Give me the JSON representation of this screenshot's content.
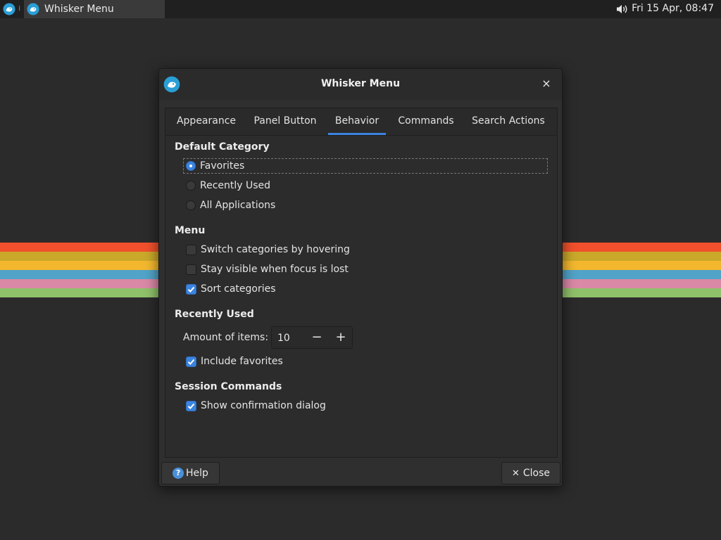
{
  "panel": {
    "menu_icon": "whisker-menu-icon",
    "separator_glyph": "⁞",
    "task_title": "Whisker Menu",
    "volume_icon": "volume-icon",
    "clock": "Fri 15 Apr, 08:47"
  },
  "wallpaper": {
    "stripe_colors": [
      "#f0512c",
      "#c9a82a",
      "#f3b72e",
      "#51a3c7",
      "#d989a5",
      "#8fc06a"
    ]
  },
  "dialog": {
    "title": "Whisker Menu",
    "close_glyph": "×",
    "tabs": [
      {
        "label": "Appearance",
        "active": false
      },
      {
        "label": "Panel Button",
        "active": false
      },
      {
        "label": "Behavior",
        "active": true
      },
      {
        "label": "Commands",
        "active": false
      },
      {
        "label": "Search Actions",
        "active": false
      }
    ],
    "default_category": {
      "heading": "Default Category",
      "options": [
        {
          "label": "Favorites",
          "selected": true
        },
        {
          "label": "Recently Used",
          "selected": false
        },
        {
          "label": "All Applications",
          "selected": false
        }
      ]
    },
    "menu": {
      "heading": "Menu",
      "options": [
        {
          "label": "Switch categories by hovering",
          "checked": false
        },
        {
          "label": "Stay visible when focus is lost",
          "checked": false
        },
        {
          "label": "Sort categories",
          "checked": true
        }
      ]
    },
    "recently_used": {
      "heading": "Recently Used",
      "amount_label": "Amount of items:",
      "amount_value": "10",
      "minus_glyph": "−",
      "plus_glyph": "+",
      "include_favorites": {
        "label": "Include favorites",
        "checked": true
      }
    },
    "session_commands": {
      "heading": "Session Commands",
      "show_confirmation": {
        "label": "Show confirmation dialog",
        "checked": true
      }
    },
    "buttons": {
      "help": "Help",
      "help_glyph": "?",
      "close": "Close",
      "close_glyph": "✕"
    },
    "accent": "#3b84e0"
  }
}
